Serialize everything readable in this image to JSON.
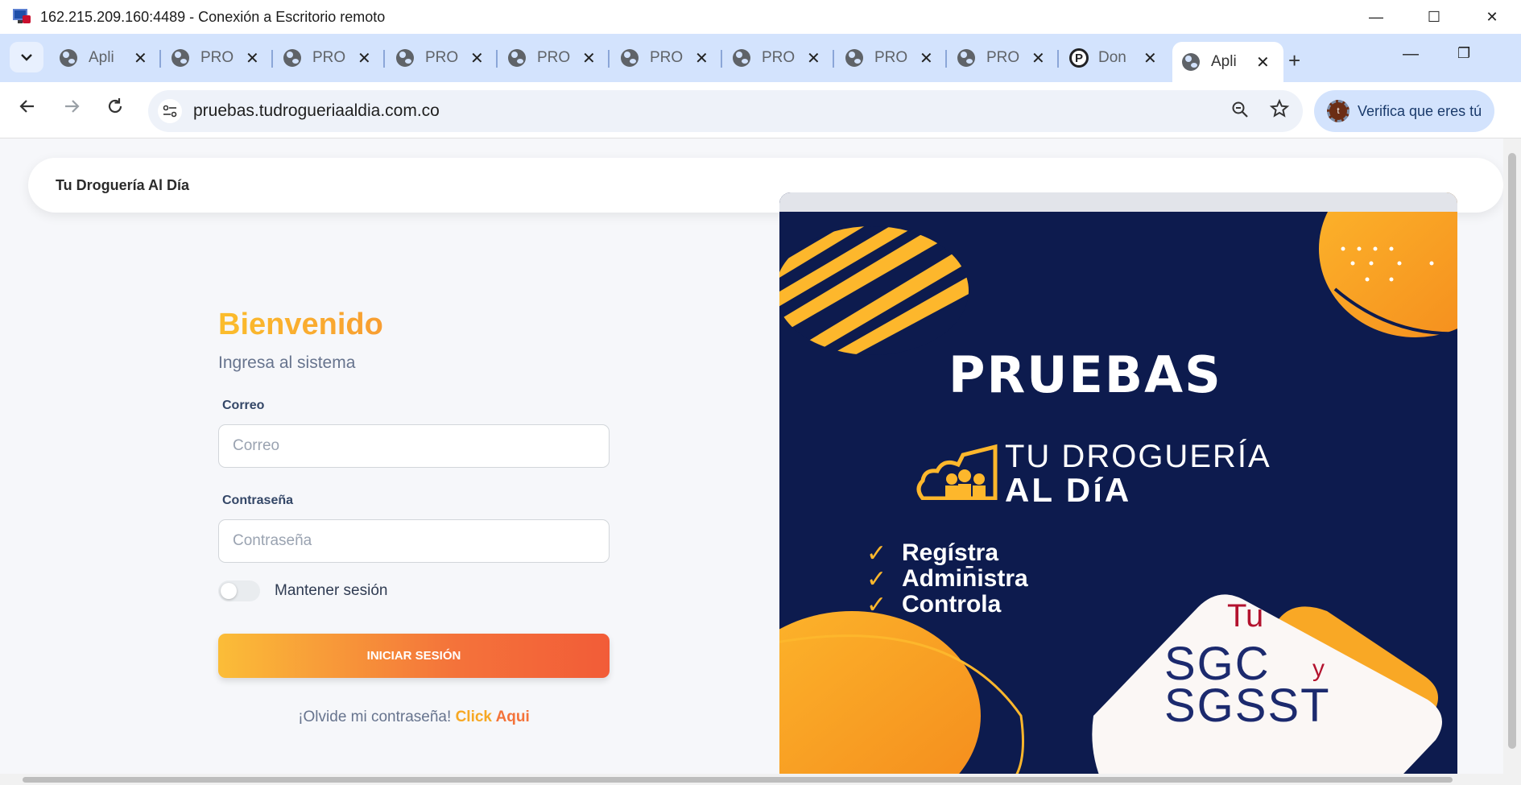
{
  "rdp_window": {
    "title": "162.215.209.160:4489 - Conexión a Escritorio remoto",
    "controls": {
      "minimize": "—",
      "maximize": "☐",
      "close": "✕"
    }
  },
  "browser": {
    "tabs": [
      {
        "title": "Apli",
        "icon": "globe-icon"
      },
      {
        "title": "PRO",
        "icon": "globe-icon"
      },
      {
        "title": "PRO",
        "icon": "globe-icon"
      },
      {
        "title": "PRO",
        "icon": "globe-icon"
      },
      {
        "title": "PRO",
        "icon": "globe-icon"
      },
      {
        "title": "PRO",
        "icon": "globe-icon"
      },
      {
        "title": "PRO",
        "icon": "globe-icon"
      },
      {
        "title": "PRO",
        "icon": "globe-icon"
      },
      {
        "title": "PRO",
        "icon": "globe-icon"
      },
      {
        "title": "Don",
        "icon": "p-icon"
      },
      {
        "title": "Apli",
        "icon": "globe-icon",
        "active": true
      }
    ],
    "tab_close_glyph": "✕",
    "new_tab_glyph": "+",
    "url": "pruebas.tudrogueriaaldia.com.co",
    "profile_button": {
      "label": "Verifica que eres tú",
      "avatar_letter": "t"
    }
  },
  "page": {
    "brand": "Tu Droguería Al Día",
    "login": {
      "title": "Bienvenido",
      "subtitle": "Ingresa al sistema",
      "email_label": "Correo",
      "email_placeholder": "Correo",
      "password_label": "Contraseña",
      "password_placeholder": "Contraseña",
      "keep_session_label": "Mantener sesión",
      "keep_session_on": false,
      "submit_label": "INICIAR SESIÓN",
      "forgot_text": "¡Olvide mi contraseña!",
      "forgot_link_1": "Click",
      "forgot_link_2": "Aqui"
    },
    "promo": {
      "headline": "PRUEBAS",
      "logo_line1": "TU DROGUERÍA",
      "logo_line2": "AL DíA",
      "bullets": [
        "Regístra",
        "Admin̄istra",
        "Controla"
      ],
      "badge_small": "Tu",
      "badge_line1": "SGC",
      "badge_conj": "y",
      "badge_line2": "SGSST",
      "colors": {
        "background": "#0d1b4e",
        "accent": "#f9a825",
        "badge_red": "#b3122e"
      }
    }
  }
}
